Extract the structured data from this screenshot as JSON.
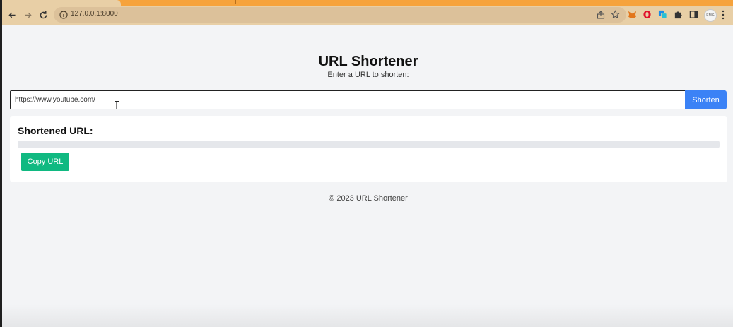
{
  "browser": {
    "url": "127.0.0.1:8000",
    "profile_label": "EMG",
    "colors": {
      "tab_strip": "#f6a33c",
      "toolbar": "#e8cfa6"
    }
  },
  "page": {
    "title": "URL Shortener",
    "subtitle": "Enter a URL to shorten:",
    "input_value": "https://www.youtube.com/",
    "shorten_label": "Shorten",
    "result_heading": "Shortened URL:",
    "shortened_url": "",
    "copy_label": "Copy URL",
    "footer": "© 2023 URL Shortener",
    "colors": {
      "shorten_button": "#3b82f6",
      "copy_button": "#10b981"
    }
  }
}
